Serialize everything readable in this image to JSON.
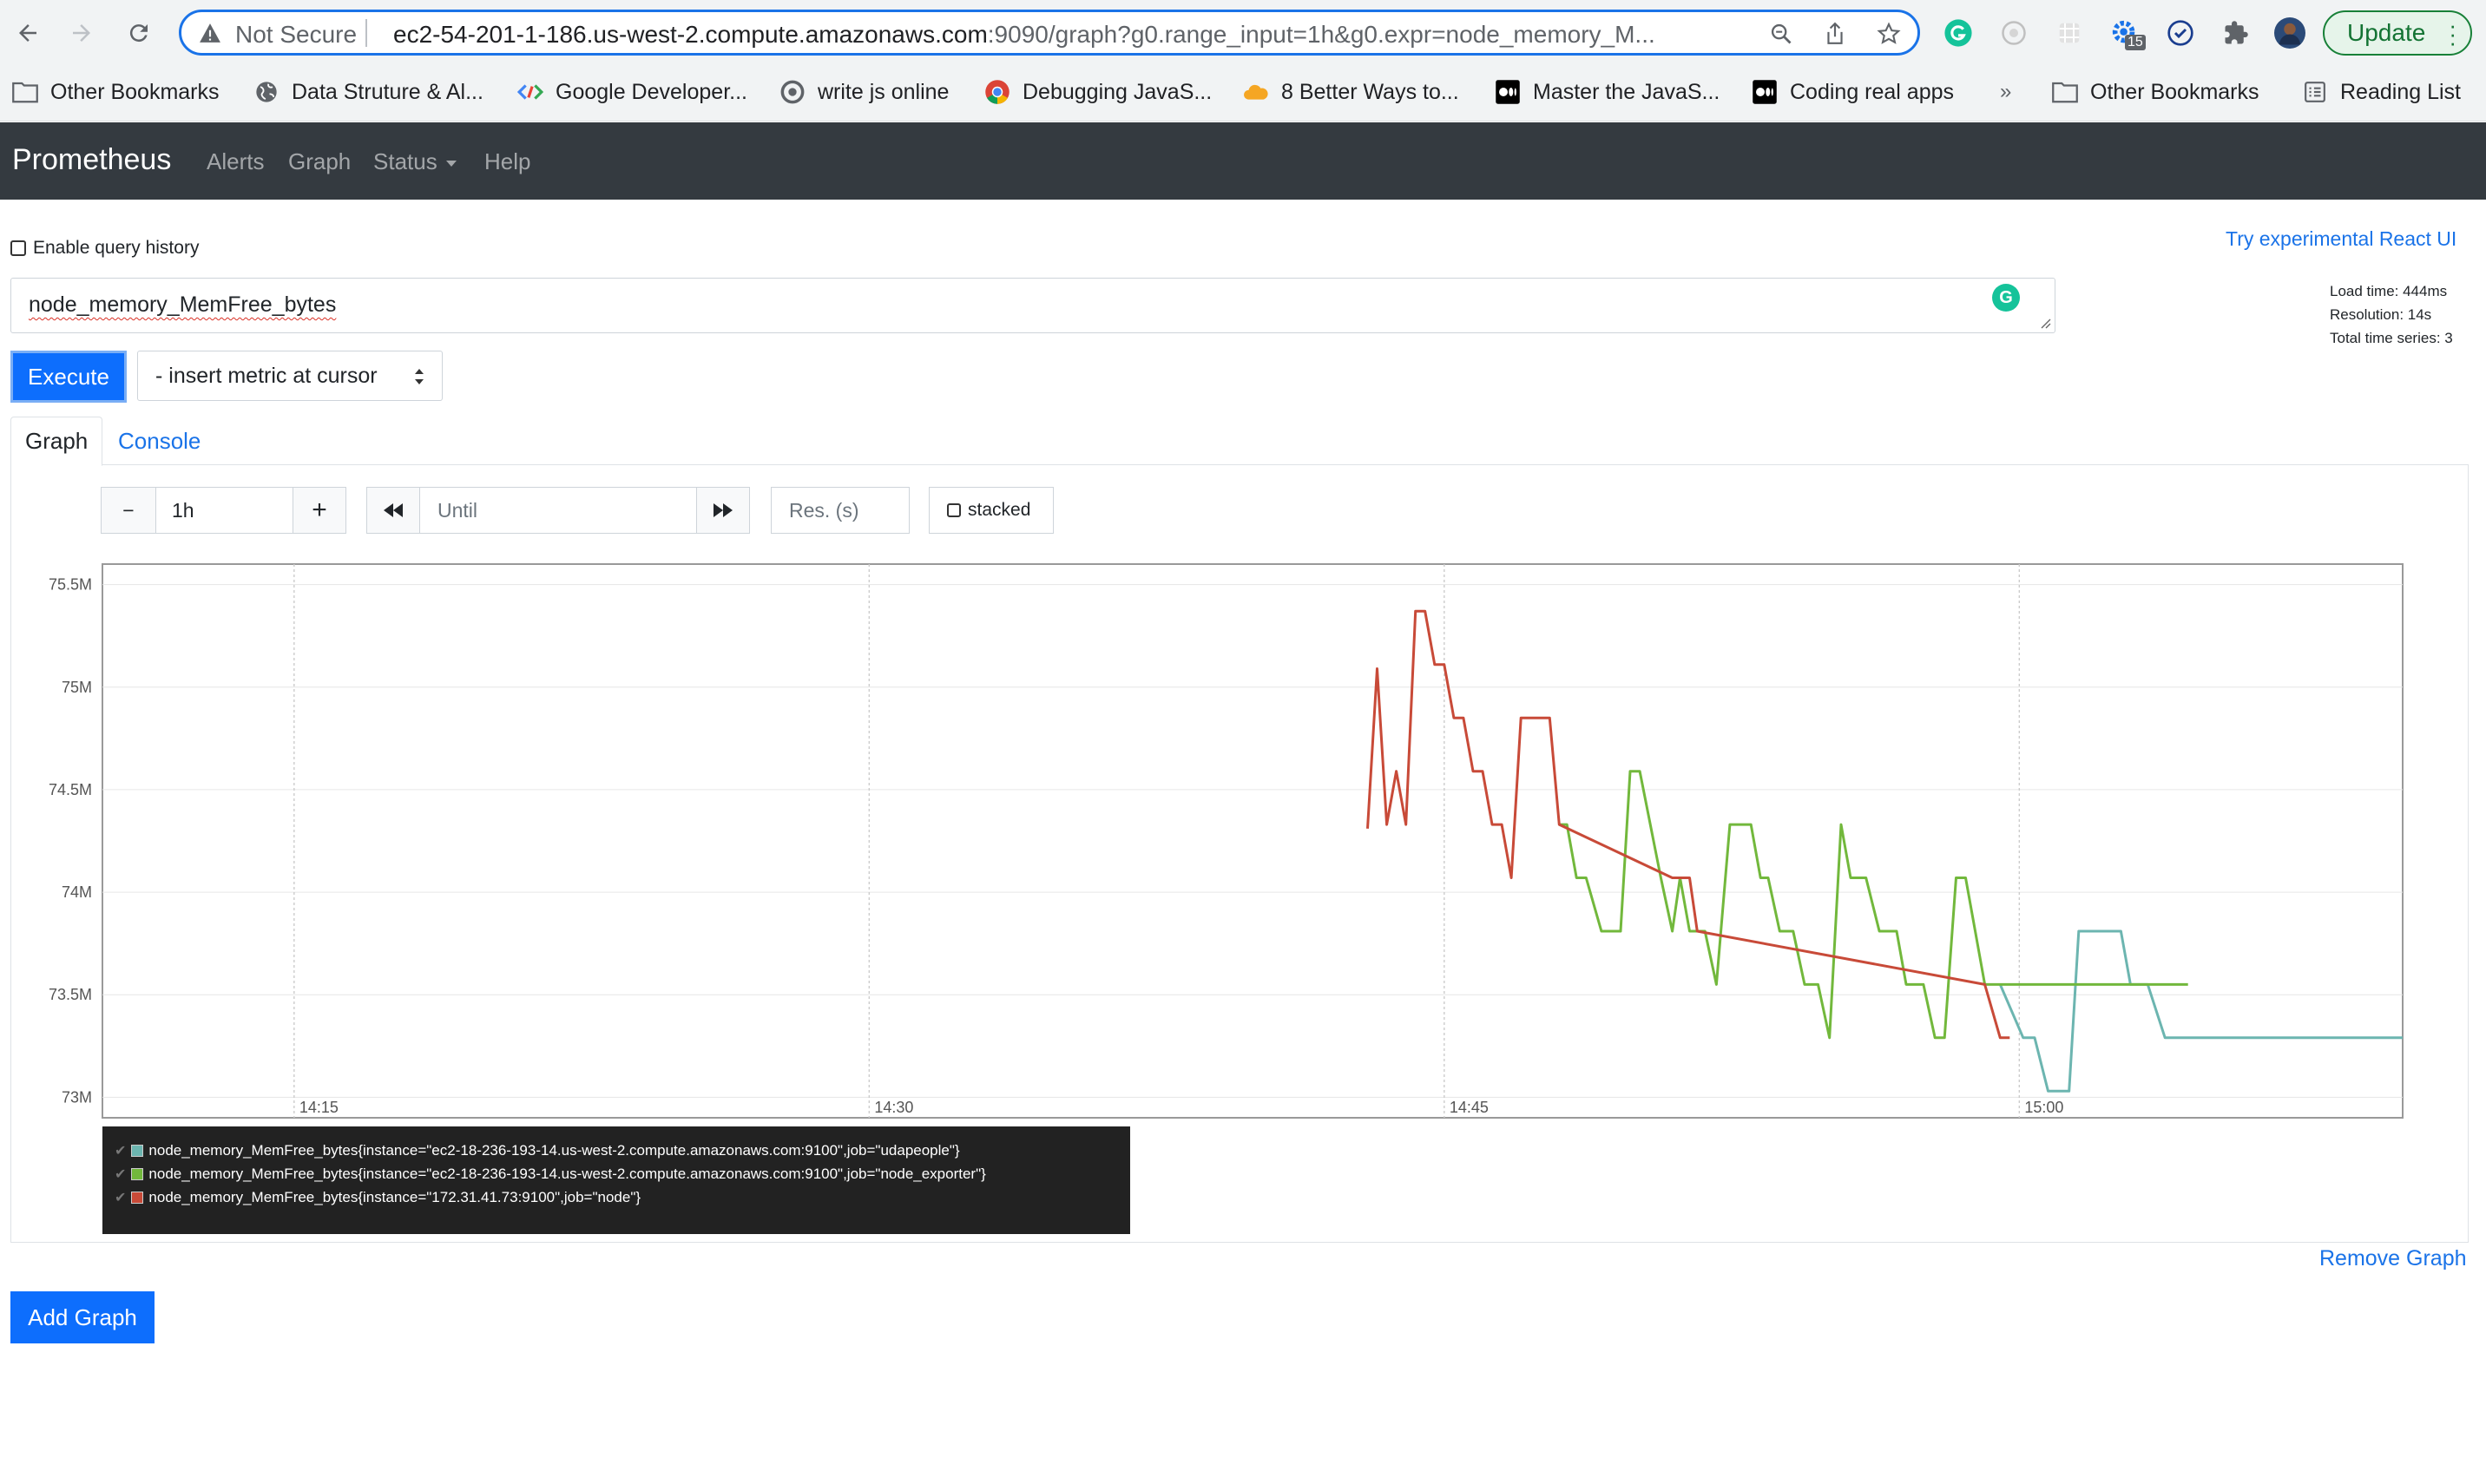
{
  "browser": {
    "security_label": "Not Secure",
    "url_host": "ec2-54-201-1-186.us-west-2.compute.amazonaws.com",
    "url_rest": ":9090/graph?g0.range_input=1h&g0.expr=node_memory_M...",
    "update_label": "Update",
    "extension_badge": "15",
    "bookmarks": [
      {
        "label": "Other Bookmarks",
        "icon": "folder-icon"
      },
      {
        "label": "Data Struture & Al...",
        "icon": "globe-icon"
      },
      {
        "label": "Google Developer...",
        "icon": "google-developers-icon"
      },
      {
        "label": "write js online",
        "icon": "site-icon"
      },
      {
        "label": "Debugging JavaS...",
        "icon": "chrome-icon"
      },
      {
        "label": "8 Better Ways to...",
        "icon": "cloud-icon"
      },
      {
        "label": "Master the JavaS...",
        "icon": "medium-icon"
      },
      {
        "label": "Coding real apps",
        "icon": "medium-icon"
      }
    ],
    "bookmarks_overflow": "»",
    "other_bookmarks": "Other Bookmarks",
    "reading_list": "Reading List"
  },
  "navbar": {
    "brand": "Prometheus",
    "links": [
      "Alerts",
      "Graph",
      "Status",
      "Help"
    ]
  },
  "page": {
    "query_history_label": "Enable query history",
    "react_ui_link": "Try experimental React UI",
    "expression": "node_memory_MemFree_bytes",
    "execute_label": "Execute",
    "metric_select": "- insert metric at cursor",
    "stats": {
      "load_time": "Load time: 444ms",
      "resolution": "Resolution: 14s",
      "total_series": "Total time series: 3"
    },
    "tabs": [
      "Graph",
      "Console"
    ],
    "active_tab": "Graph",
    "controls": {
      "minus": "−",
      "range": "1h",
      "plus": "+",
      "until_placeholder": "Until",
      "res_placeholder": "Res. (s)",
      "stacked_label": "stacked"
    },
    "remove_graph": "Remove Graph",
    "add_graph": "Add Graph"
  },
  "chart_data": {
    "type": "line",
    "x_unit": "time (HH:MM)",
    "x_range": [
      "14:10",
      "15:10"
    ],
    "x_ticks": [
      "14:15",
      "14:30",
      "14:45",
      "15:00"
    ],
    "y_ticks": [
      "73M",
      "73.5M",
      "74M",
      "74.5M",
      "75M",
      "75.5M"
    ],
    "ylim": [
      72.9,
      75.6
    ],
    "y_unit": "M bytes",
    "grid": true,
    "series": [
      {
        "name": "node_memory_MemFree_bytes{instance=\"ec2-18-236-193-14.us-west-2.compute.amazonaws.com:9100\",job=\"udapeople\"}",
        "color": "#6cb5b0",
        "points": [
          [
            "14:59.50",
            73.55
          ],
          [
            "15:00.10",
            73.29
          ],
          [
            "15:00.40",
            73.29
          ],
          [
            "15:00.75",
            73.03
          ],
          [
            "15:01.30",
            73.03
          ],
          [
            "15:01.55",
            73.81
          ],
          [
            "15:02.65",
            73.81
          ],
          [
            "15:02.90",
            73.55
          ],
          [
            "15:03.35",
            73.55
          ],
          [
            "15:03.80",
            73.29
          ],
          [
            "15:10.00",
            73.29
          ]
        ]
      },
      {
        "name": "node_memory_MemFree_bytes{instance=\"ec2-18-236-193-14.us-west-2.compute.amazonaws.com:9100\",job=\"node_exporter\"}",
        "color": "#72b83c",
        "points": [
          [
            "14:48.00",
            74.33
          ],
          [
            "14:48.20",
            74.33
          ],
          [
            "14:48.45",
            74.07
          ],
          [
            "14:48.70",
            74.07
          ],
          [
            "14:49.10",
            73.81
          ],
          [
            "14:49.60",
            73.81
          ],
          [
            "14:49.85",
            74.59
          ],
          [
            "14:50.10",
            74.59
          ],
          [
            "14:50.65",
            74.07
          ],
          [
            "14:50.95",
            73.81
          ],
          [
            "14:51.15",
            74.07
          ],
          [
            "14:51.40",
            73.81
          ],
          [
            "14:51.80",
            73.81
          ],
          [
            "14:52.10",
            73.55
          ],
          [
            "14:52.45",
            74.33
          ],
          [
            "14:53.00",
            74.33
          ],
          [
            "14:53.25",
            74.07
          ],
          [
            "14:53.45",
            74.07
          ],
          [
            "14:53.75",
            73.81
          ],
          [
            "14:54.10",
            73.81
          ],
          [
            "14:54.40",
            73.55
          ],
          [
            "14:54.75",
            73.55
          ],
          [
            "14:55.05",
            73.29
          ],
          [
            "14:55.35",
            74.33
          ],
          [
            "14:55.60",
            74.07
          ],
          [
            "14:56.00",
            74.07
          ],
          [
            "14:56.35",
            73.81
          ],
          [
            "14:56.80",
            73.81
          ],
          [
            "14:57.05",
            73.55
          ],
          [
            "14:57.50",
            73.55
          ],
          [
            "14:57.80",
            73.29
          ],
          [
            "14:58.05",
            73.29
          ],
          [
            "14:58.35",
            74.07
          ],
          [
            "14:58.60",
            74.07
          ],
          [
            "14:59.10",
            73.55
          ],
          [
            "15:04.40",
            73.55
          ]
        ]
      },
      {
        "name": "node_memory_MemFree_bytes{instance=\"172.31.41.73:9100\",job=\"node\"}",
        "color": "#c84a38",
        "points": [
          [
            "14:43.00",
            74.31
          ],
          [
            "14:43.25",
            75.09
          ],
          [
            "14:43.50",
            74.33
          ],
          [
            "14:43.75",
            74.59
          ],
          [
            "14:44.00",
            74.33
          ],
          [
            "14:44.25",
            75.37
          ],
          [
            "14:44.50",
            75.37
          ],
          [
            "14:44.75",
            75.11
          ],
          [
            "14:45.00",
            75.11
          ],
          [
            "14:45.25",
            74.85
          ],
          [
            "14:45.50",
            74.85
          ],
          [
            "14:45.75",
            74.59
          ],
          [
            "14:46.00",
            74.59
          ],
          [
            "14:46.25",
            74.33
          ],
          [
            "14:46.50",
            74.33
          ],
          [
            "14:46.75",
            74.07
          ],
          [
            "14:47.00",
            74.85
          ],
          [
            "14:47.75",
            74.85
          ],
          [
            "14:48.00",
            74.33
          ],
          [
            "14:50.95",
            74.07
          ],
          [
            "14:51.40",
            74.07
          ],
          [
            "14:51.60",
            73.81
          ],
          [
            "14:59.10",
            73.55
          ],
          [
            "14:59.50",
            73.29
          ],
          [
            "14:59.75",
            73.29
          ]
        ]
      }
    ]
  }
}
